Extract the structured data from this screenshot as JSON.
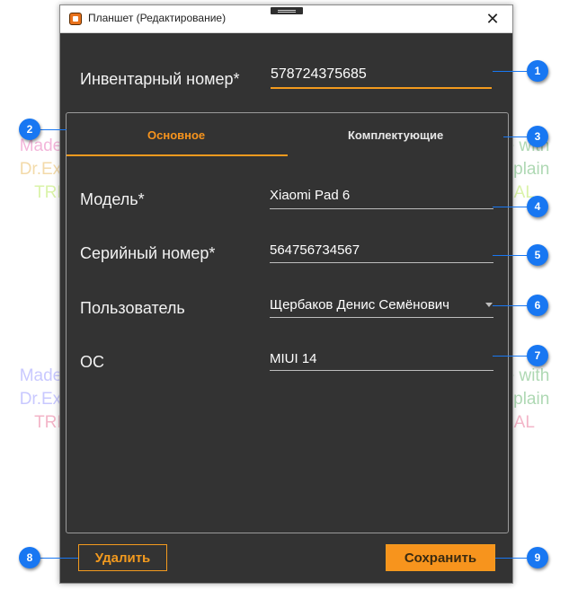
{
  "window": {
    "title": "Планшет (Редактирование)",
    "close_glyph": "✕"
  },
  "form": {
    "inventory_label": "Инвентарный номер*",
    "inventory_value": "578724375685"
  },
  "tabs": [
    {
      "label": "Основное",
      "active": true
    },
    {
      "label": "Комплектующие",
      "active": false
    }
  ],
  "fields": {
    "model_label": "Модель*",
    "model_value": "Xiaomi Pad 6",
    "serial_label": "Серийный номер*",
    "serial_value": "564756734567",
    "user_label": "Пользователь",
    "user_value": "Щербаков Денис Семёнович",
    "os_label": "ОС",
    "os_value": "MIUI 14"
  },
  "buttons": {
    "delete_label": "Удалить",
    "save_label": "Сохранить"
  },
  "callouts": [
    "1",
    "2",
    "3",
    "4",
    "5",
    "6",
    "7",
    "8",
    "9"
  ],
  "watermark": {
    "line1": "Made with",
    "line2": "Dr.Explain",
    "line3": "TRIAL"
  },
  "colors": {
    "accent": "#f7941d",
    "window_bg": "#333333",
    "callout": "#1877f2"
  }
}
